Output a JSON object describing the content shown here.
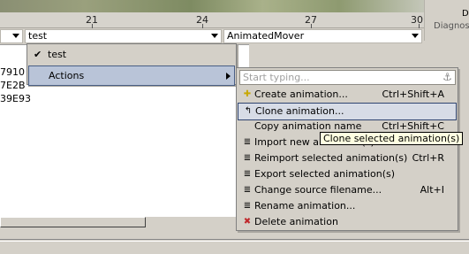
{
  "timeline": {
    "ticks": [
      "21",
      "24",
      "27",
      "30"
    ]
  },
  "right_panel": {
    "label_d": "D",
    "label_diag": "Diagnose"
  },
  "combos": {
    "left_stub": "",
    "test": "test",
    "animator": "AnimatedMover"
  },
  "list": {
    "rows": [
      "7910",
      "7E2B",
      "39E93"
    ]
  },
  "menu1": {
    "items": [
      {
        "label": "test",
        "checked": "✔"
      },
      {
        "label": "Actions"
      }
    ]
  },
  "menu2": {
    "search_placeholder": "Start typing...",
    "items": [
      {
        "icon": "plus-icon",
        "label": "Create animation...",
        "shortcut": "Ctrl+Shift+A"
      },
      {
        "icon": "clone-icon",
        "label": "Clone animation...",
        "shortcut": ""
      },
      {
        "icon": "",
        "label": "Copy animation name",
        "shortcut": "Ctrl+Shift+C"
      },
      {
        "icon": "list-icon",
        "label": "Import new animation(s)...",
        "shortcut": "I"
      },
      {
        "icon": "list-icon",
        "label": "Reimport selected animation(s)",
        "shortcut": "Ctrl+R"
      },
      {
        "icon": "list-icon",
        "label": "Export selected animation(s)",
        "shortcut": ""
      },
      {
        "icon": "list-icon",
        "label": "Change source filename...",
        "shortcut": "Alt+I"
      },
      {
        "icon": "list-icon",
        "label": "Rename animation...",
        "shortcut": ""
      },
      {
        "icon": "x-icon",
        "label": "Delete animation",
        "shortcut": ""
      }
    ]
  },
  "tooltip": "Clone selected animation(s)"
}
